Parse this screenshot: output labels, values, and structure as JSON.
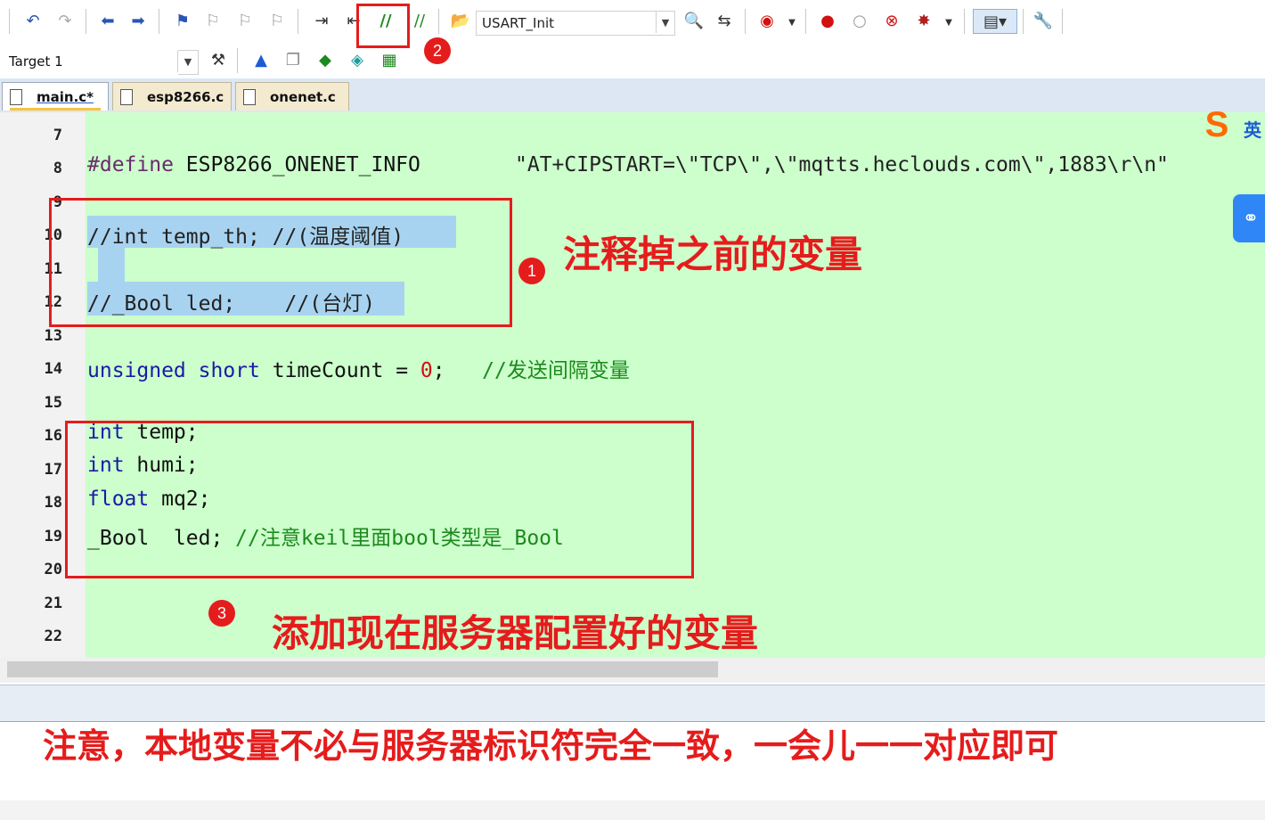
{
  "toolbar": {
    "function_combo_value": "USART_Init",
    "target_combo_value": "Target 1",
    "icons_row1": [
      "undo-icon",
      "redo-icon",
      "back-icon",
      "forward-icon",
      "bookmark-icon",
      "prev-bookmark-icon",
      "next-bookmark-icon",
      "clear-bookmarks-icon",
      "indent-icon",
      "unindent-icon",
      "comment-selection-icon",
      "uncomment-selection-icon",
      "open-file-icon",
      "find-icon",
      "find-in-files-icon",
      "debug-session-icon",
      "breakpoint-icon",
      "disable-breakpoint-icon",
      "kill-breakpoints-icon",
      "toggle-breakpoint-icon",
      "window-layout-icon",
      "configure-icon"
    ],
    "icons_row2": [
      "translate-icon",
      "build-icon",
      "rebuild-icon",
      "download-icon",
      "options-icon",
      "manage-components-icon"
    ]
  },
  "tabs": [
    {
      "label": "main.c*",
      "active": true
    },
    {
      "label": "esp8266.c",
      "active": false
    },
    {
      "label": "onenet.c",
      "active": false
    }
  ],
  "editor": {
    "line_numbers": [
      "7",
      "8",
      "9",
      "10",
      "11",
      "12",
      "13",
      "14",
      "15",
      "16",
      "17",
      "18",
      "19",
      "20",
      "21",
      "22"
    ],
    "line8": {
      "directive": "#define",
      "name": " ESP8266_ONENET_INFO",
      "value": "\"AT+CIPSTART=\\\"TCP\\\",\\\"mqtts.heclouds.com\\\",1883\\r\\n\""
    },
    "line10": "//int temp_th; //(温度阈值)",
    "line12": "//_Bool led;    //(台灯)",
    "line14": {
      "kw1": "unsigned",
      "kw2": "short",
      "ident": " timeCount = ",
      "num": "0",
      "semi": ";",
      "comment": "//发送间隔变量"
    },
    "line16": {
      "kw": "int",
      "rest": " temp;"
    },
    "line17": {
      "kw": "int",
      "rest": " humi;"
    },
    "line18": {
      "kw": "float",
      "rest": " mq2;"
    },
    "line19": {
      "code": "_Bool  led; ",
      "comment": "//注意keil里面bool类型是_Bool"
    }
  },
  "annotations": {
    "badge1": "1",
    "badge2": "2",
    "badge3": "3",
    "note1": "注释掉之前的变量",
    "note3": "添加现在服务器配置好的变量",
    "bottom_note": "注意，本地变量不必与服务器标识符完全一致，一会儿一一对应即可",
    "accent_color": "#e51c1c"
  },
  "ime": {
    "logo": "S",
    "mode": "英"
  },
  "colors": {
    "editor_bg": "#ccffcc",
    "selection": "#a8d3f0",
    "keyword": "#1a1aa6",
    "comment": "#1c8a1c"
  }
}
